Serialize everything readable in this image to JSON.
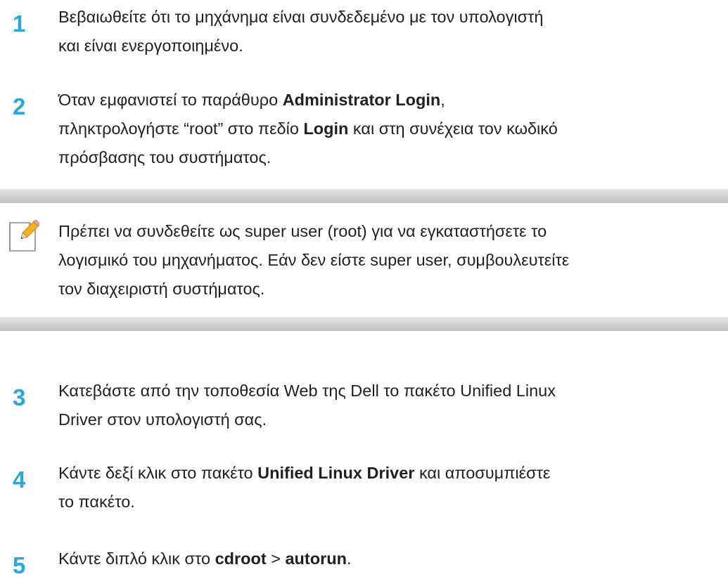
{
  "steps": [
    {
      "number": "1",
      "lines": [
        [
          {
            "text": "Βεβαιωθείτε ότι το μηχάνημα είναι συνδεδεμένο με τον υπολογιστή",
            "bold": false
          }
        ],
        [
          {
            "text": "και είναι ενεργοποιημένο.",
            "bold": false
          }
        ]
      ]
    },
    {
      "number": "2",
      "lines": [
        [
          {
            "text": "Όταν εμφανιστεί το παράθυρο ",
            "bold": false
          },
          {
            "text": "Administrator Login",
            "bold": true
          },
          {
            "text": ",",
            "bold": false
          }
        ],
        [
          {
            "text": "πληκτρολογήστε “root” στο πεδίο ",
            "bold": false
          },
          {
            "text": "Login",
            "bold": true
          },
          {
            "text": " και στη συνέχεια τον κωδικό",
            "bold": false
          }
        ],
        [
          {
            "text": "πρόσβασης του συστήματος.",
            "bold": false
          }
        ]
      ]
    },
    {
      "number": "3",
      "lines": [
        [
          {
            "text": "Κατεβάστε από την τοποθεσία Web της Dell το πακέτο Unified Linux",
            "bold": false
          }
        ],
        [
          {
            "text": "Driver στον υπολογιστή σας.",
            "bold": false
          }
        ]
      ]
    },
    {
      "number": "4",
      "lines": [
        [
          {
            "text": "Κάντε δεξί κλικ στο πακέτο ",
            "bold": false
          },
          {
            "text": "Unified Linux Driver",
            "bold": true
          },
          {
            "text": " και αποσυμπιέστε",
            "bold": false
          }
        ],
        [
          {
            "text": "το πακέτο.",
            "bold": false
          }
        ]
      ]
    },
    {
      "number": "5",
      "lines": [
        [
          {
            "text": "Κάντε διπλό κλικ στο ",
            "bold": false
          },
          {
            "text": "cdroot",
            "bold": true
          },
          {
            "text": " > ",
            "bold": false
          },
          {
            "text": "autorun",
            "bold": true
          },
          {
            "text": ".",
            "bold": false
          }
        ]
      ]
    }
  ],
  "note": {
    "icon": "note-pencil-icon",
    "lines": [
      "Πρέπει να συνδεθείτε ως super user (root) για να εγκαταστήσετε το",
      "λογισμικό του μηχανήματος. Εάν δεν είστε super user, συμβουλευτείτε",
      "τον διαχειριστή συστήματος."
    ]
  },
  "colors": {
    "step_number": "#2aa6df",
    "text": "#231f20",
    "note_bar": "#c8c8c8",
    "icon_pencil": "#f7b21a"
  }
}
